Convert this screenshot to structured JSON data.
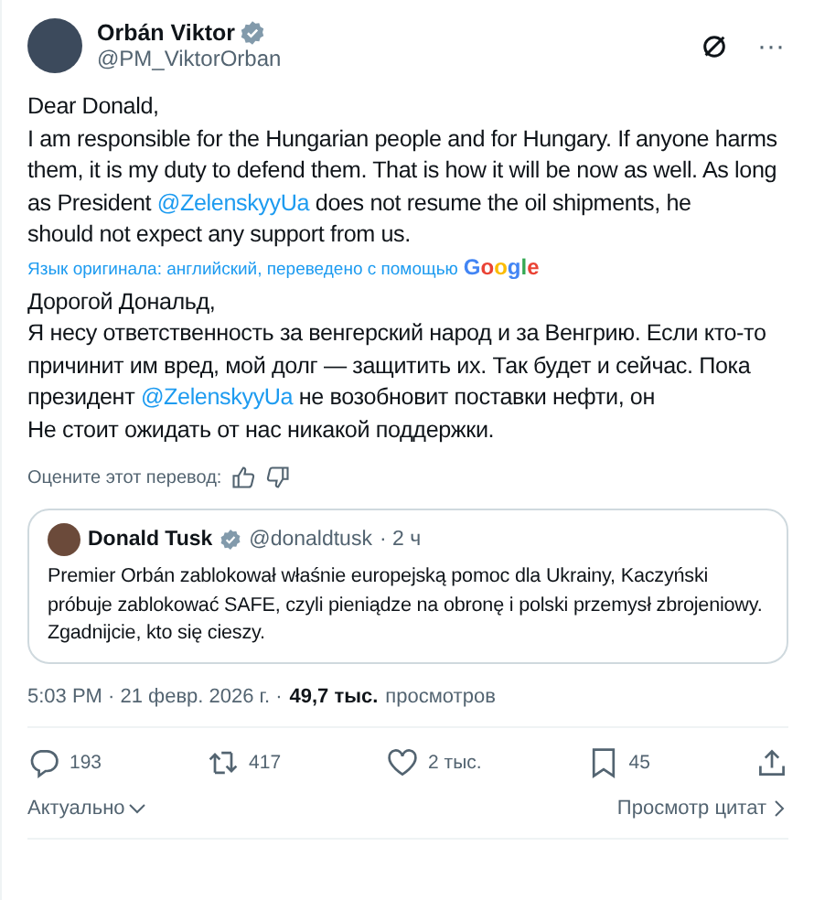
{
  "post": {
    "author": {
      "name": "Orbán Viktor",
      "handle": "@PM_ViktorOrban",
      "verified": true
    },
    "more": "···",
    "text": [
      {
        "kind": "text",
        "text": "Dear Donald,\nI am responsible for the Hungarian people and for Hungary. If anyone harms them, it is my duty to defend them. That is how it will be now as well. As long as President "
      },
      {
        "kind": "mention",
        "text": "@ZelenskyyUa"
      },
      {
        "kind": "text",
        "text": " does not resume the oil shipments, he\n should not expect any support from us."
      }
    ],
    "translation_note": "Язык оригинала: английский, переведено с помощью",
    "translation_brand": "Google",
    "translation": [
      {
        "kind": "text",
        "text": "Дорогой Дональд,\nЯ несу ответственность за венгерский народ и за Венгрию. Если кто-то причинит им вред, мой долг — защитить их. Так будет и сейчас. Пока президент "
      },
      {
        "kind": "mention",
        "text": "@ZelenskyyUa"
      },
      {
        "kind": "text",
        "text": " не возобновит поставки нефти, он\nНе стоит ожидать от нас никакой поддержки."
      }
    ],
    "rate_label": "Оцените этот перевод:",
    "quote": {
      "name": "Donald Tusk",
      "verified": true,
      "handle": "@donaldtusk",
      "time": "· 2 ч",
      "text": "Premier Orbán zablokował właśnie europejską pomoc dla Ukrainy, Kaczyński próbuje zablokować SAFE, czyli pieniądze na obronę i polski przemysł zbrojeniowy. Zgadnijcie, kto się cieszy."
    },
    "meta": {
      "time": "5:03 PM · 21 февр. 2026 г. ·",
      "views": "49,7 тыс.",
      "views_label": "просмотров"
    },
    "actions": [
      {
        "kind": "reply",
        "count": "193"
      },
      {
        "kind": "repost",
        "count": "417"
      },
      {
        "kind": "like",
        "count": "2 тыс."
      },
      {
        "kind": "bookmark",
        "count": "45"
      },
      {
        "kind": "share"
      }
    ],
    "sort": "Актуально",
    "quotes_link": "Просмотр цитат"
  }
}
